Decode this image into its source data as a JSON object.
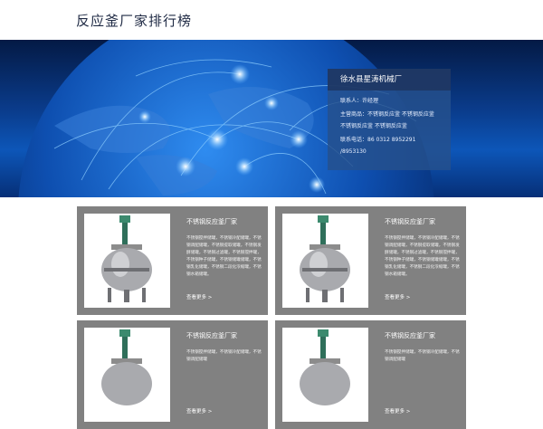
{
  "header": {
    "title": "反应釜厂家排行榜"
  },
  "banner": {
    "accent": "#0d56b8"
  },
  "company": {
    "name": "徐水县星涛机械厂",
    "contact": "联系人：许经理",
    "products_line1": "主营商品：不锈钢反应釜 不锈钢反应釜",
    "products_line2": "不锈钢反应釜 不锈钢反应釜",
    "phone_line1": "联系电话：86 0312 8952291",
    "phone_line2": "/8953130"
  },
  "products": [
    {
      "title": "不锈钢反应釜厂家",
      "desc": "不锈钢搅拌储罐，不锈钢冷配储罐，不锈钢调配储罐，不锈钢提取储罐，不锈钢发酵储罐，不锈钢过滤罐，不锈钢搅拌罐，不锈钢种子储罐，不锈钢储罐储罐，不锈钢乳化储罐，不锈钢二段化浓缩罐，不锈钢水箱储罐。",
      "more": "查看更多 >"
    },
    {
      "title": "不锈钢反应釜厂家",
      "desc": "不锈钢搅拌储罐，不锈钢冷配储罐，不锈钢调配储罐，不锈钢提取储罐，不锈钢发酵储罐，不锈钢过滤罐，不锈钢搅拌罐，不锈钢种子储罐，不锈钢储罐储罐，不锈钢乳化储罐，不锈钢二段化浓缩罐，不锈钢水箱储罐。",
      "more": "查看更多 >"
    },
    {
      "title": "不锈钢反应釜厂家",
      "desc": "不锈钢搅拌储罐，不锈钢冷配储罐，不锈钢调配储罐",
      "more": "查看更多 >"
    },
    {
      "title": "不锈钢反应釜厂家",
      "desc": "不锈钢搅拌储罐，不锈钢冷配储罐，不锈钢调配储罐",
      "more": "查看更多 >"
    }
  ]
}
